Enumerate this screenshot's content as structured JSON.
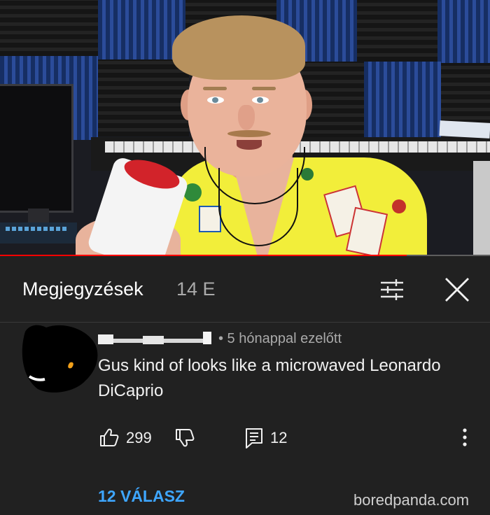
{
  "video": {
    "progress_fraction": 0.83
  },
  "comments_panel": {
    "title": "Megjegyzések",
    "count": "14 E",
    "filter_icon": "sort-filter-icon",
    "close_icon": "close-icon"
  },
  "comment": {
    "meta": "• 5 hónappal ezelőtt",
    "text": "Gus kind of looks like a microwaved Leonardo DiCaprio",
    "likes": "299",
    "replies_count": "12",
    "like_icon": "thumbs-up-icon",
    "dislike_icon": "thumbs-down-icon",
    "reply_icon": "reply-comment-icon",
    "more_icon": "more-vertical-icon",
    "view_replies_label": "12 VÁLASZ"
  },
  "watermark": "boredpanda.com",
  "colors": {
    "background": "#212121",
    "link_blue": "#3ea6ff",
    "progress_red": "#ff0000",
    "secondary_text": "#aaaaaa"
  }
}
